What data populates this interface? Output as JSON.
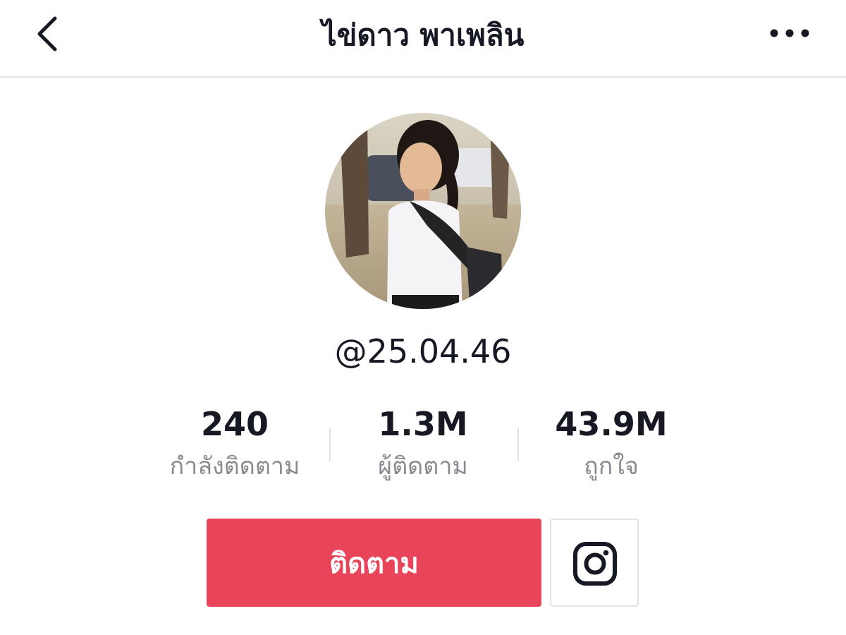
{
  "header": {
    "title": "ไข่ดาว พาเพลิน",
    "back_icon": "chevron-left-icon",
    "more_icon": "more-horizontal-icon"
  },
  "profile": {
    "username": "@25.04.46",
    "avatar": "profile-photo"
  },
  "stats": [
    {
      "value": "240",
      "label": "กำลังติดตาม"
    },
    {
      "value": "1.3M",
      "label": "ผู้ติดตาม"
    },
    {
      "value": "43.9M",
      "label": "ถูกใจ"
    }
  ],
  "actions": {
    "follow_label": "ติดตาม",
    "instagram_icon": "instagram-icon"
  },
  "colors": {
    "accent": "#e8455a",
    "text_primary": "#161823",
    "text_secondary": "#8a8b91",
    "divider": "#e3e3e4"
  }
}
